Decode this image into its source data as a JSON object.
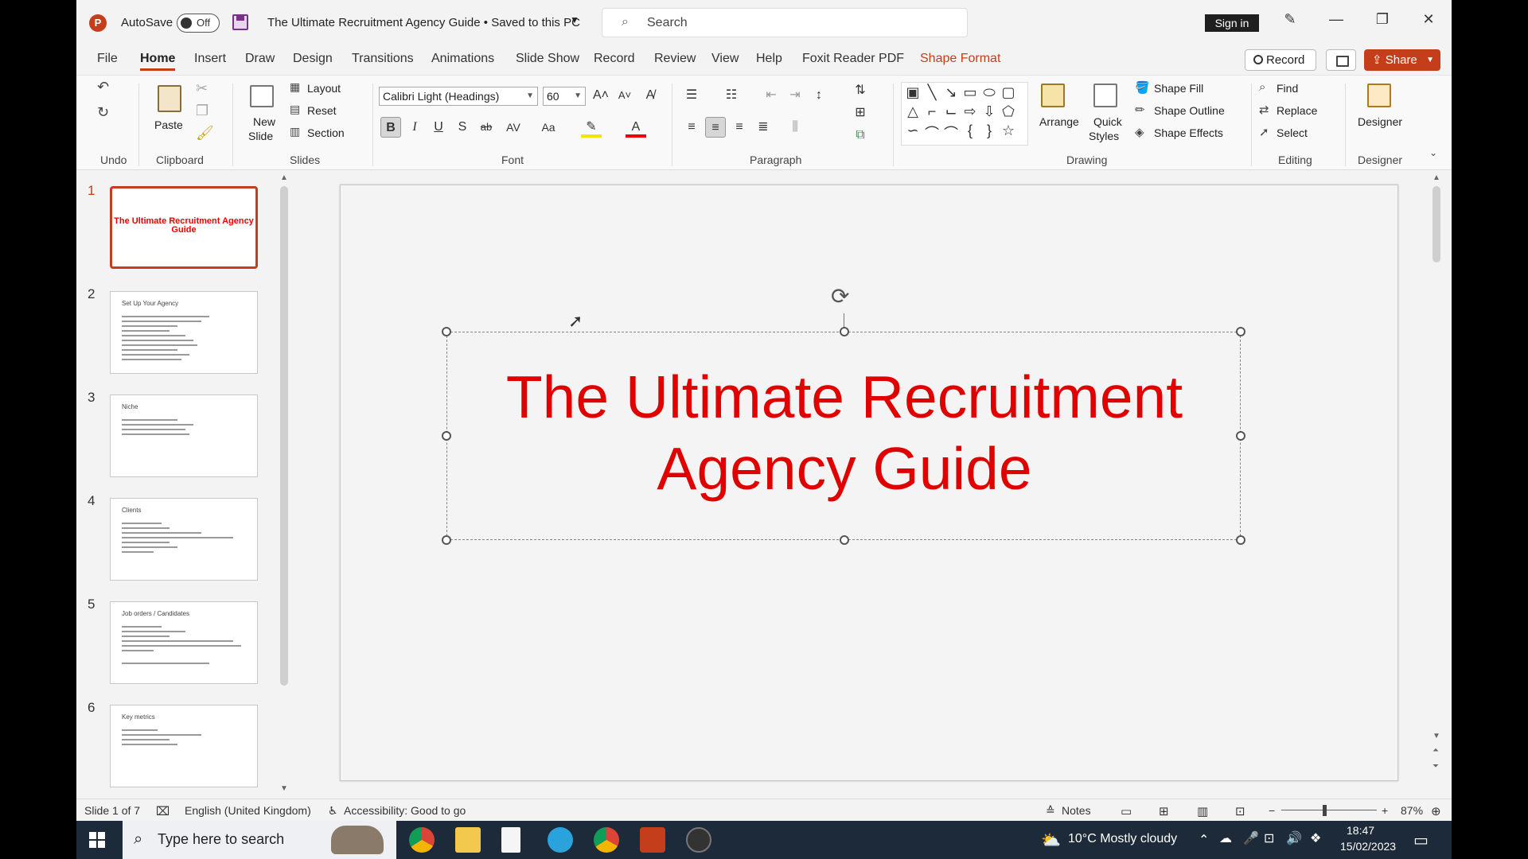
{
  "titlebar": {
    "autosave_label": "AutoSave",
    "autosave_state": "Off",
    "doc_title": "The Ultimate Recruitment Agency Guide • Saved to this PC",
    "search_placeholder": "Search",
    "sign_in": "Sign in"
  },
  "menu": {
    "items": [
      "File",
      "Home",
      "Insert",
      "Draw",
      "Design",
      "Transitions",
      "Animations",
      "Slide Show",
      "Record",
      "Review",
      "View",
      "Help",
      "Foxit Reader PDF",
      "Shape Format"
    ],
    "active": "Home",
    "record_label": "Record",
    "share_label": "Share"
  },
  "ribbon": {
    "groups": {
      "undo": "Undo",
      "clipboard": "Clipboard",
      "slides": "Slides",
      "font": "Font",
      "paragraph": "Paragraph",
      "drawing": "Drawing",
      "editing": "Editing",
      "designer": "Designer"
    },
    "paste": "Paste",
    "new_slide": [
      "New",
      "Slide"
    ],
    "layout": "Layout",
    "reset": "Reset",
    "section": "Section",
    "font_name": "Calibri Light (Headings)",
    "font_size": "60",
    "arrange": "Arrange",
    "quick_styles": [
      "Quick",
      "Styles"
    ],
    "shape_fill": "Shape Fill",
    "shape_outline": "Shape Outline",
    "shape_effects": "Shape Effects",
    "find": "Find",
    "replace": "Replace",
    "select": "Select",
    "designer_btn": "Designer"
  },
  "thumbnails": [
    {
      "num": "1",
      "title": "The Ultimate Recruitment Agency Guide",
      "active": true
    },
    {
      "num": "2",
      "title": "Set Up Your Agency"
    },
    {
      "num": "3",
      "title": "Niche"
    },
    {
      "num": "4",
      "title": "Clients"
    },
    {
      "num": "5",
      "title": "Job orders / Candidates"
    },
    {
      "num": "6",
      "title": "Key metrics"
    }
  ],
  "slide": {
    "title_line1": "The Ultimate Recruitment",
    "title_line2": "Agency Guide",
    "title_color": "#e00000"
  },
  "status": {
    "slide_of": "Slide 1 of 7",
    "language": "English (United Kingdom)",
    "accessibility": "Accessibility: Good to go",
    "notes": "Notes",
    "zoom": "87%"
  },
  "taskbar": {
    "search_placeholder": "Type here to search",
    "weather": "10°C  Mostly cloudy",
    "time": "18:47",
    "date": "15/02/2023"
  },
  "colors": {
    "accent": "#c43e1c"
  }
}
